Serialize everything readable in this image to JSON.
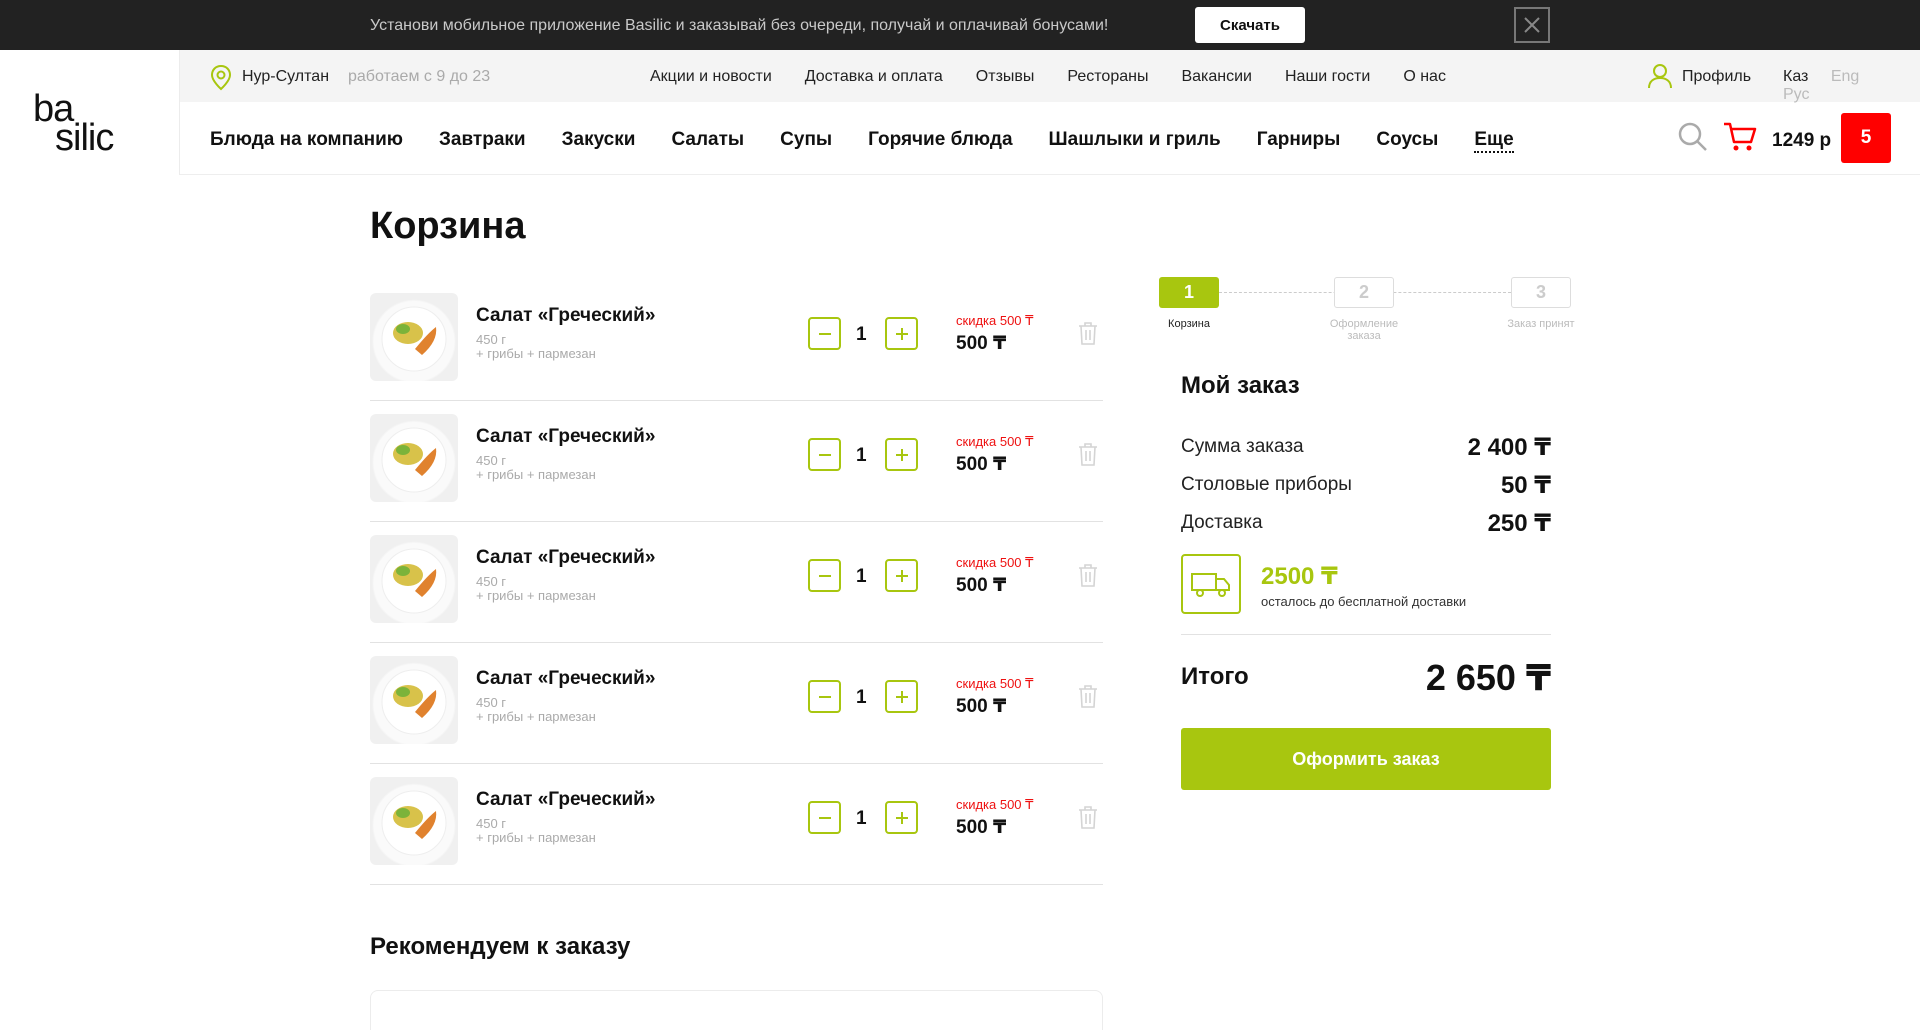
{
  "banner": {
    "text": "Установи мобильное приложение Basilic и заказывай без очереди, получай и оплачивай бонусами!",
    "button_label": "Скачать"
  },
  "logo": {
    "line1": "ba",
    "line2": "silic"
  },
  "subheader": {
    "city": "Нур-Султан",
    "hours": "работаем с 9 до 23",
    "links": [
      "Акции и новости",
      "Доставка и оплата",
      "Отзывы",
      "Рестораны",
      "Вакансии",
      "Наши гости",
      "О нас"
    ],
    "profile": "Профиль",
    "languages": [
      "Каз",
      "Eng",
      "Рус"
    ],
    "active_language": "Каз"
  },
  "nav": {
    "categories": [
      "Блюда на компанию",
      "Завтраки",
      "Закуски",
      "Салаты",
      "Супы",
      "Горячие блюда",
      "Шашлыки и гриль",
      "Гарниры",
      "Соусы"
    ],
    "more": "Еще",
    "cart_total": "1249 р",
    "cart_count": "5"
  },
  "page": {
    "title": "Корзина"
  },
  "cart": {
    "items": [
      {
        "name": "Салат «Греческий»",
        "weight": "450 г",
        "extras": "+ грибы + пармезан",
        "quantity": "1",
        "discount": "скидка 500 ₸",
        "price": "500 ₸"
      },
      {
        "name": "Салат «Греческий»",
        "weight": "450 г",
        "extras": "+ грибы + пармезан",
        "quantity": "1",
        "discount": "скидка 500 ₸",
        "price": "500 ₸"
      },
      {
        "name": "Салат «Греческий»",
        "weight": "450 г",
        "extras": "+ грибы + пармезан",
        "quantity": "1",
        "discount": "скидка 500 ₸",
        "price": "500 ₸"
      },
      {
        "name": "Салат «Греческий»",
        "weight": "450 г",
        "extras": "+ грибы + пармезан",
        "quantity": "1",
        "discount": "скидка 500 ₸",
        "price": "500 ₸"
      },
      {
        "name": "Салат «Греческий»",
        "weight": "450 г",
        "extras": "+ грибы + пармезан",
        "quantity": "1",
        "discount": "скидка 500 ₸",
        "price": "500 ₸"
      }
    ]
  },
  "steps": [
    {
      "number": "1",
      "label": "Корзина",
      "active": true
    },
    {
      "number": "2",
      "label": "Оформление заказа",
      "active": false
    },
    {
      "number": "3",
      "label": "Заказ принят",
      "active": false
    }
  ],
  "summary": {
    "title": "Мой заказ",
    "rows": [
      {
        "label": "Сумма заказа",
        "value": "2 400 ₸"
      },
      {
        "label": "Столовые приборы",
        "value": "50 ₸"
      },
      {
        "label": "Доставка",
        "value": "250 ₸"
      }
    ],
    "free_delivery_amount": "2500 ₸",
    "free_delivery_note": "осталось до бесплатной доставки",
    "total_label": "Итого",
    "total_value": "2 650 ₸",
    "checkout_label": "Оформить заказ"
  },
  "recommend": {
    "title": "Рекомендуем к заказу"
  },
  "colors": {
    "accent": "#a8c60f",
    "danger": "#ff0000",
    "banner_bg": "#222222"
  }
}
